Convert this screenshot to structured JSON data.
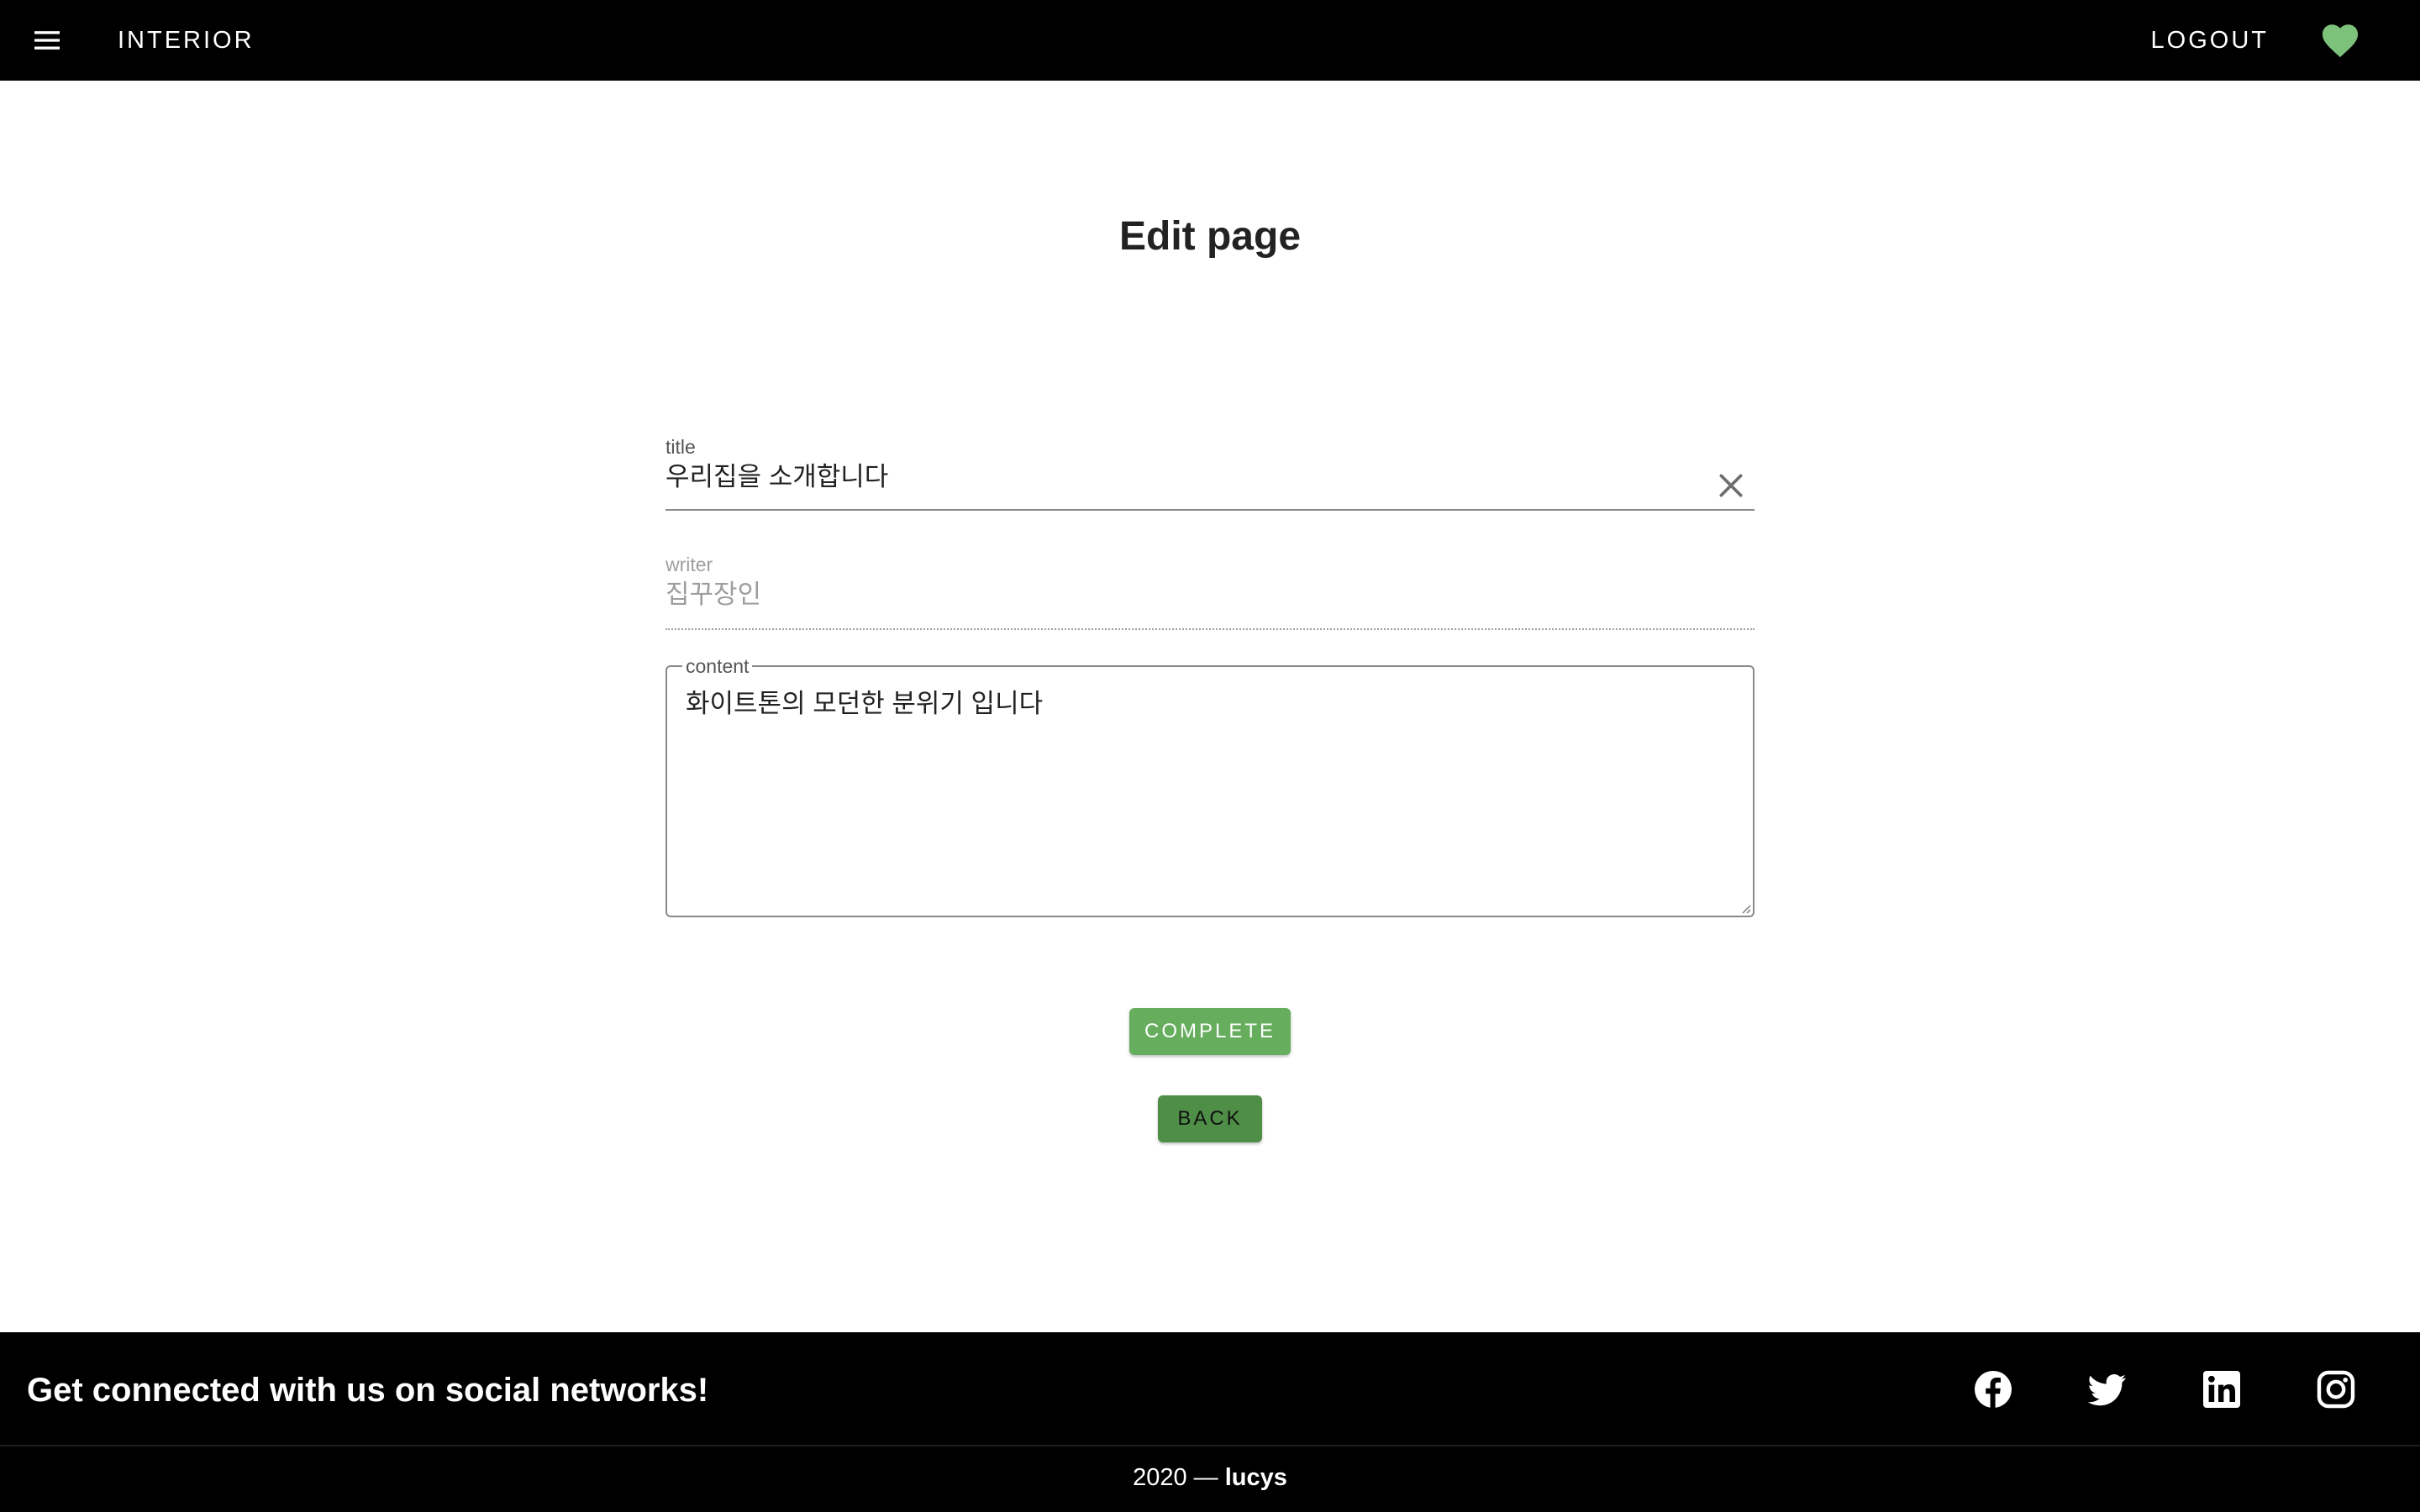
{
  "appbar": {
    "menu_icon": "hamburger-menu-icon",
    "title": "INTERIOR",
    "logout_label": "LOGOUT",
    "favorite_icon": "heart-icon",
    "favorite_color": "#7dc27a"
  },
  "main": {
    "title": "Edit page",
    "fields": {
      "title": {
        "label": "title",
        "value": "우리집을 소개합니다",
        "clear_icon": "close-icon"
      },
      "writer": {
        "label": "writer",
        "value": "집꾸장인"
      },
      "content": {
        "label": "content",
        "value": "화이트톤의 모던한 분위기 입니다"
      }
    },
    "buttons": {
      "complete": "COMPLETE",
      "back": "BACK"
    },
    "colors": {
      "complete_button": "#66ae5e",
      "back_button": "#4e8e47"
    }
  },
  "footer": {
    "tagline": "Get connected with us on social networks!",
    "social_icons": [
      "facebook-icon",
      "twitter-icon",
      "linkedin-icon",
      "instagram-icon"
    ],
    "year_prefix": "2020 — ",
    "author": "lucys"
  }
}
